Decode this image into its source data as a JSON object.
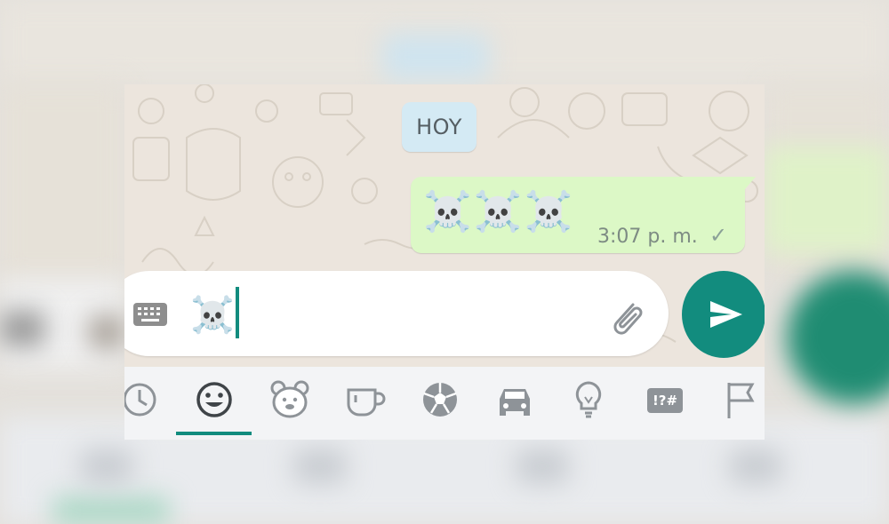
{
  "chat": {
    "date_label": "HOY",
    "message": {
      "text": "☠️☠️☠️",
      "time": "3:07 p. m.",
      "status_icon": "single-check-icon",
      "status_glyph": "✓"
    }
  },
  "composer": {
    "keyboard_icon": "keyboard-icon",
    "current_value": "☠️",
    "attach_icon": "paperclip-icon",
    "send_icon": "send-icon"
  },
  "emoji_tabs": [
    {
      "name": "recent",
      "icon": "clock-icon"
    },
    {
      "name": "smileys",
      "icon": "smiley-icon",
      "selected": true
    },
    {
      "name": "animals",
      "icon": "bear-icon"
    },
    {
      "name": "food",
      "icon": "cup-icon"
    },
    {
      "name": "activity",
      "icon": "soccer-ball-icon"
    },
    {
      "name": "travel",
      "icon": "car-icon"
    },
    {
      "name": "objects",
      "icon": "lightbulb-icon"
    },
    {
      "name": "symbols",
      "icon": "symbols-icon",
      "label": "!?#"
    },
    {
      "name": "flags",
      "icon": "flag-icon"
    }
  ],
  "colors": {
    "accent": "#128c7e",
    "bubble_out": "#dcf8c6",
    "date_pill": "#d4eaf4",
    "chat_bg": "#ece5dd"
  }
}
